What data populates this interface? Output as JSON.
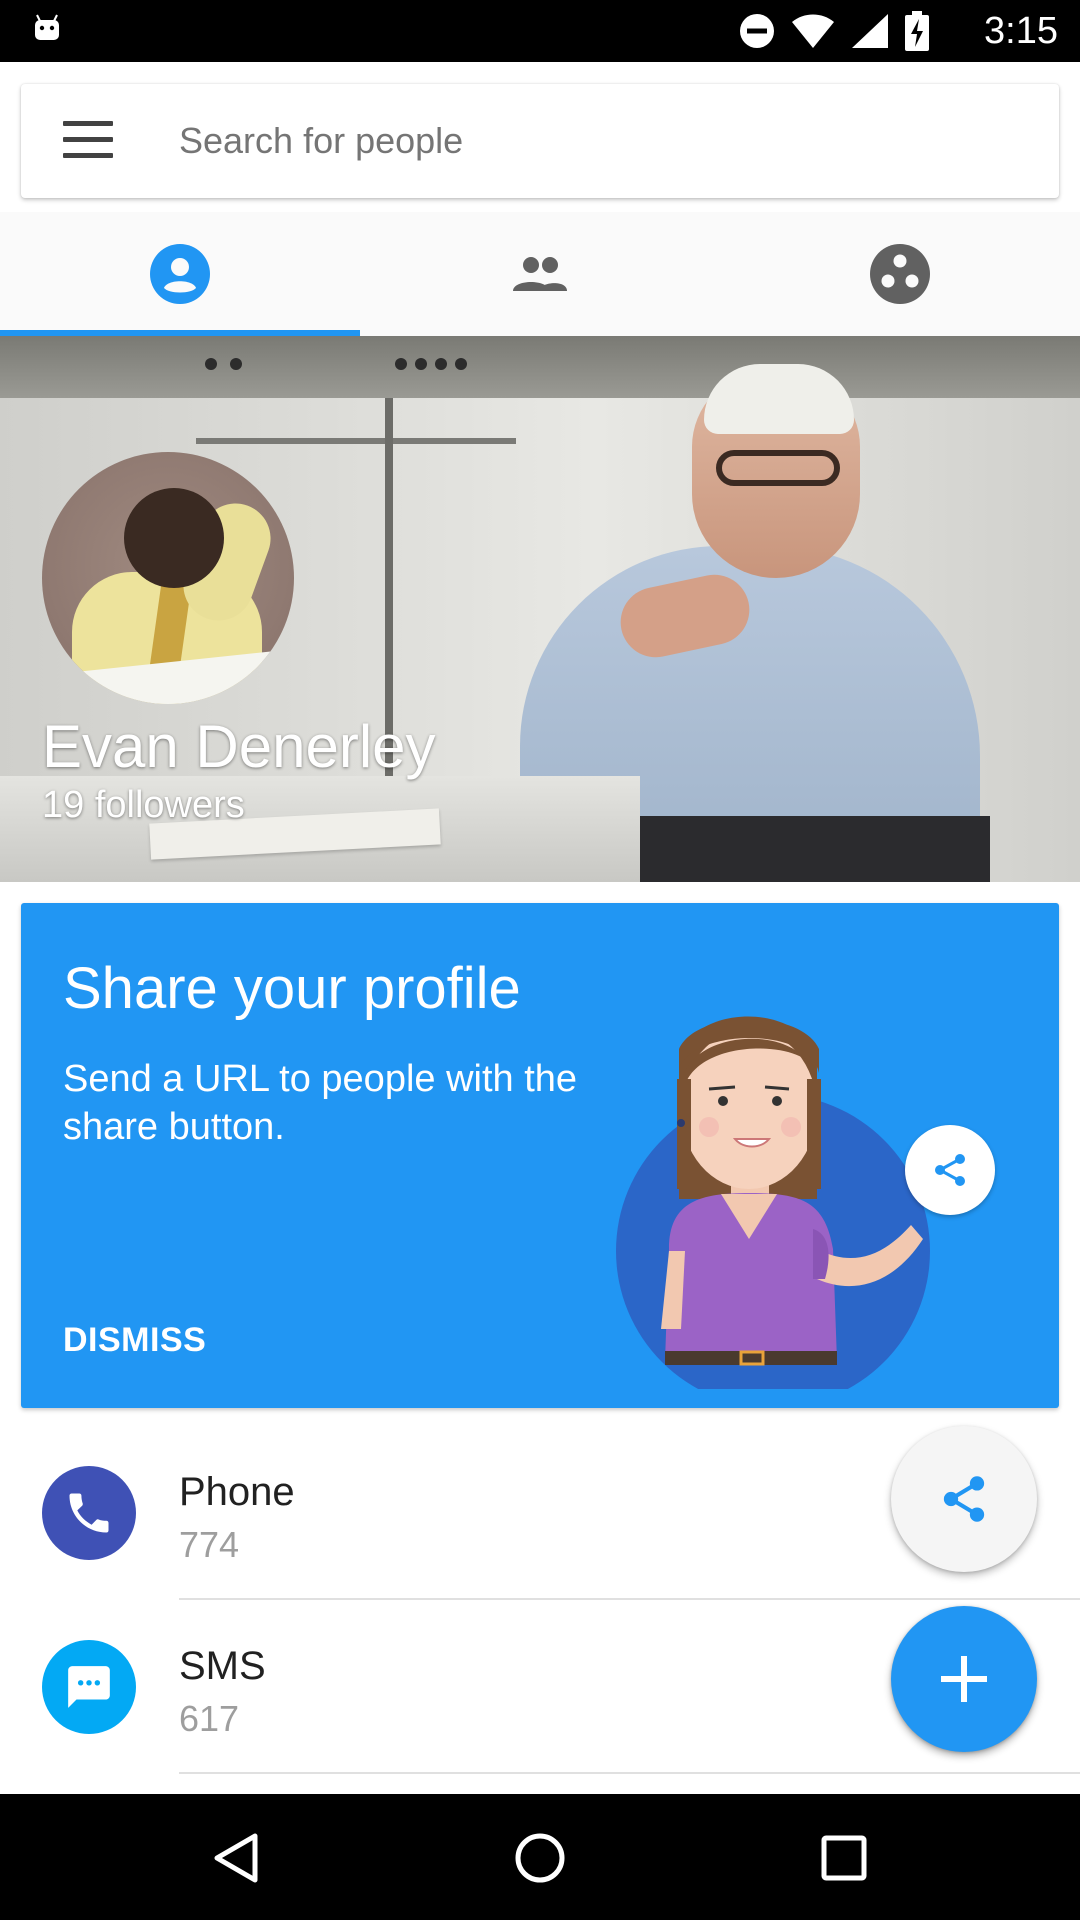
{
  "status_bar": {
    "time": "3:15",
    "icons": [
      "android-icon",
      "do-not-disturb-icon",
      "wifi-icon",
      "signal-icon",
      "battery-charging-icon"
    ]
  },
  "search": {
    "placeholder": "Search for people"
  },
  "tabs": [
    {
      "icon": "account-circle-icon",
      "selected": true
    },
    {
      "icon": "people-icon",
      "selected": false
    },
    {
      "icon": "communities-icon",
      "selected": false
    }
  ],
  "profile": {
    "name": "Evan Denerley",
    "followers": "19 followers"
  },
  "share_card": {
    "title": "Share your profile",
    "description": "Send a URL to people with the share button.",
    "dismiss_label": "DISMISS",
    "background_color": "#2196f3"
  },
  "list": [
    {
      "title": "Phone",
      "subtitle": "774",
      "icon": "phone-icon",
      "color": "#3f51b5"
    },
    {
      "title": "SMS",
      "subtitle": "617",
      "icon": "message-icon",
      "color": "#03a9f4"
    }
  ],
  "fabs": {
    "share_icon": "share-icon",
    "add_icon": "add-icon"
  },
  "nav_bar": {
    "buttons": [
      "back-icon",
      "home-icon",
      "recents-icon"
    ]
  },
  "colors": {
    "accent": "#2196f3",
    "text_primary": "#212121",
    "text_secondary": "#9e9e9e"
  }
}
